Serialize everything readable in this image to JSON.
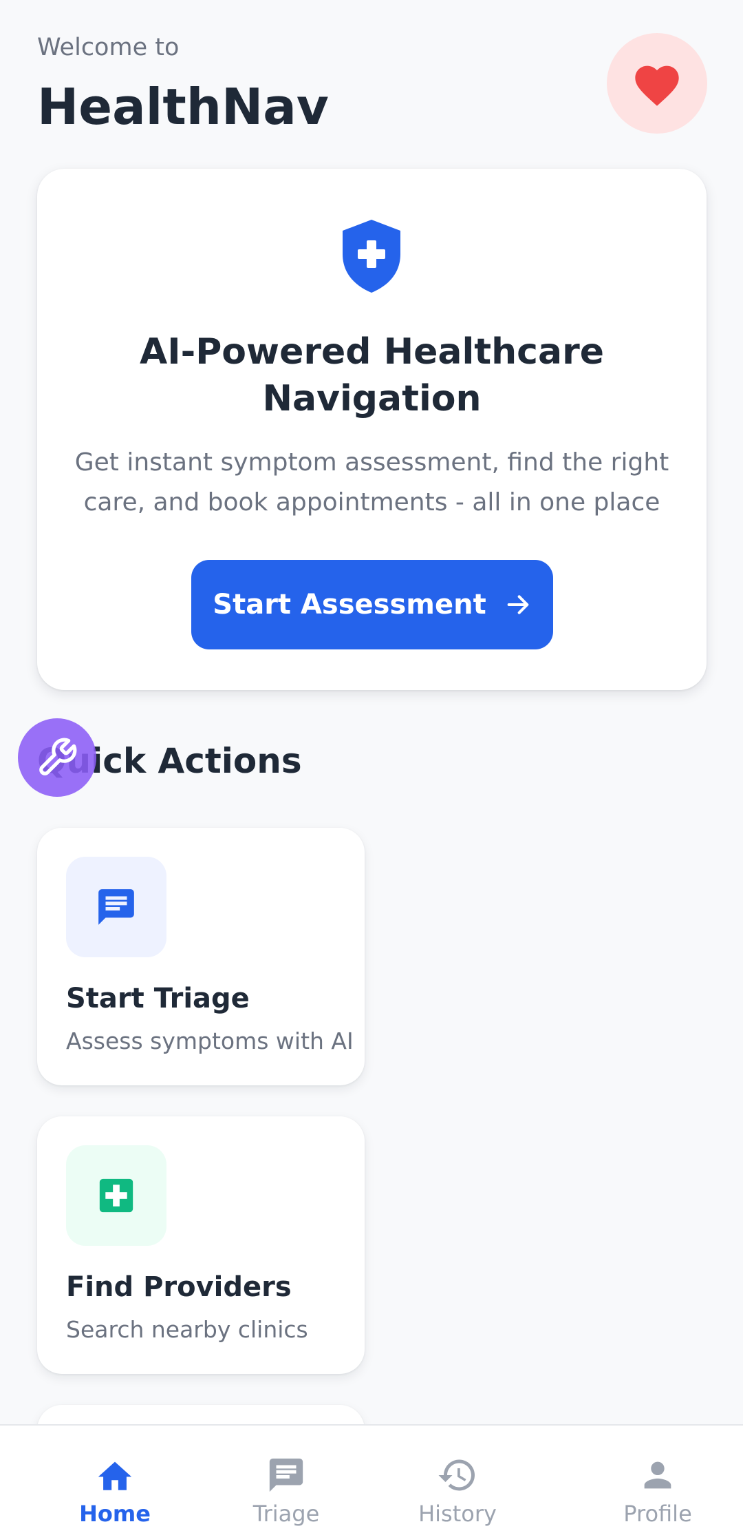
{
  "header": {
    "welcome_text": "Welcome to",
    "app_name": "HealthNav"
  },
  "hero": {
    "title": "AI-Powered Healthcare Navigation",
    "description": "Get instant symptom assessment, find the right care, and book appointments - all in one place",
    "cta_label": "Start Assessment"
  },
  "quick_actions": {
    "title": "Quick Actions",
    "items": [
      {
        "title": "Start Triage",
        "subtitle": "Assess symptoms with AI",
        "icon": "chat-icon"
      },
      {
        "title": "Find Providers",
        "subtitle": "Search nearby clinics",
        "icon": "medical-cross-icon"
      }
    ]
  },
  "bottom_nav": {
    "items": [
      {
        "label": "Home",
        "icon": "home-icon",
        "active": true
      },
      {
        "label": "Triage",
        "icon": "chat-icon",
        "active": false
      },
      {
        "label": "History",
        "icon": "history-icon",
        "active": false
      },
      {
        "label": "Profile",
        "icon": "person-icon",
        "active": false
      }
    ]
  },
  "colors": {
    "primary": "#2563eb",
    "heart": "#ef4444",
    "heart_bg": "#fee2e2",
    "green": "#10b981",
    "fab": "#8b5cf6",
    "background": "#f8f9fb"
  }
}
